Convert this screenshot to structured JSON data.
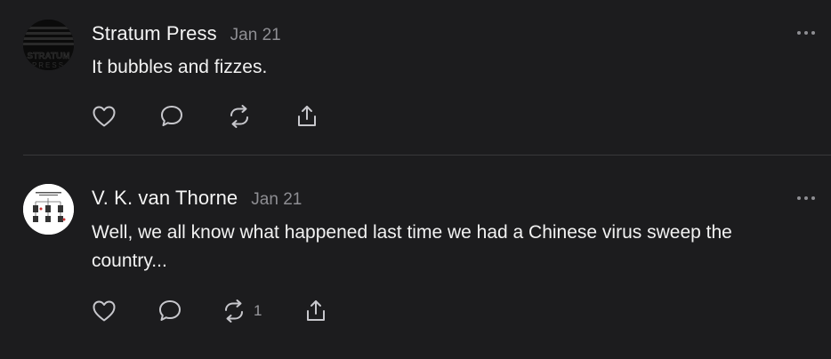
{
  "posts": [
    {
      "author": "Stratum Press",
      "date": "Jan 21",
      "text": "It bubbles and fizzes.",
      "avatar": {
        "kind": "logo",
        "logo_text": "STRATUM",
        "sub_text": "PRESS",
        "icon": "stratum-press-logo"
      },
      "actions": {
        "like_icon": "heart-icon",
        "reply_icon": "comment-icon",
        "repost_icon": "repost-icon",
        "repost_count": "",
        "share_icon": "share-icon"
      },
      "more_icon": "ellipsis-icon"
    },
    {
      "author": "V. K. van Thorne",
      "date": "Jan 21",
      "text": "Well, we all know what happened last time we had a Chinese virus sweep the country...",
      "avatar": {
        "kind": "diagram-thumbnail",
        "icon": "diagram-avatar"
      },
      "actions": {
        "like_icon": "heart-icon",
        "reply_icon": "comment-icon",
        "repost_icon": "repost-icon",
        "repost_count": "1",
        "share_icon": "share-icon"
      },
      "more_icon": "ellipsis-icon"
    }
  ],
  "colors": {
    "background": "#1c1c1e",
    "text": "#f2f2f2",
    "muted": "#8e8e93",
    "divider": "#38383a",
    "icon": "#c7c7cc"
  }
}
